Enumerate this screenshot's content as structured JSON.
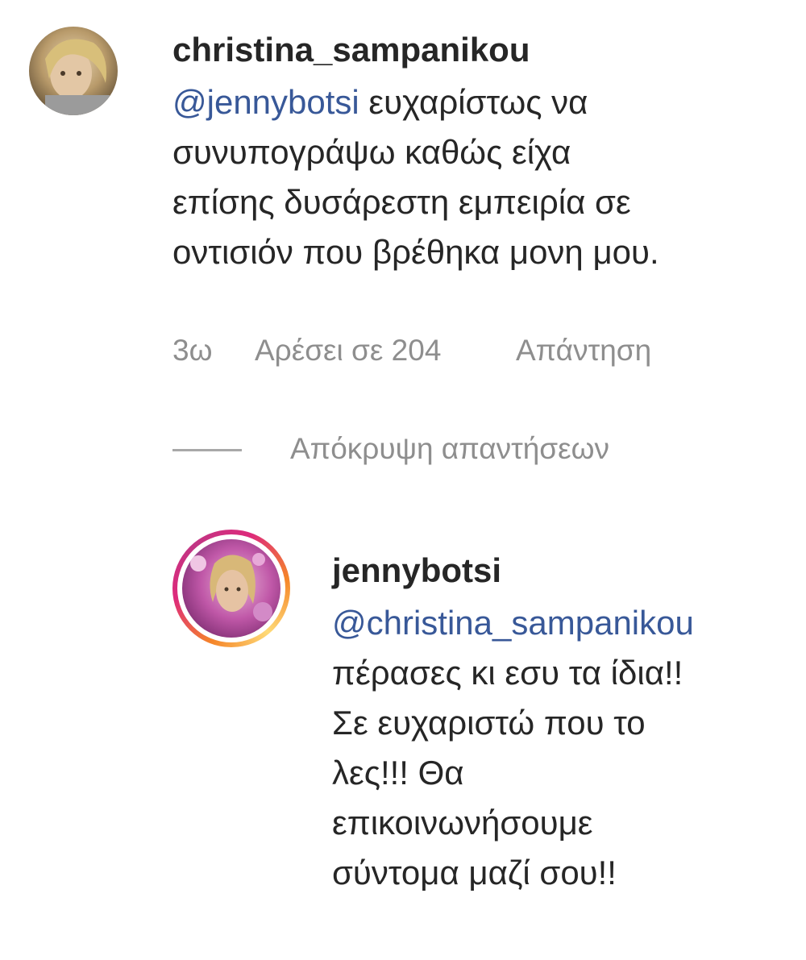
{
  "comment": {
    "username": "christina_sampanikou",
    "mention": "@jennybotsi",
    "lines": [
      " ευχαρίστως να",
      "συνυπογράψω καθώς είχα",
      "επίσης δυσάρεστη εμπειρία σε",
      "οντισιόν που βρέθηκα μονη μου."
    ],
    "time": "3ω",
    "likes": "Αρέσει σε 204",
    "reply_label": "Απάντηση",
    "hide_replies_label": "Απόκρυψη απαντήσεων"
  },
  "reply": {
    "username": "jennybotsi",
    "mention": "@christina_sampanikou",
    "lines": [
      "πέρασες κι εσυ τα ίδια!!",
      "Σε ευχαριστώ που το",
      "λες!!! Θα",
      "επικοινωνήσουμε",
      "σύντομα μαζί σου!!"
    ]
  },
  "colors": {
    "text": "#262626",
    "mention": "#385898",
    "meta": "#8e8e8e",
    "story_ring_start": "#f58529",
    "story_ring_end": "#dd2a7b"
  }
}
